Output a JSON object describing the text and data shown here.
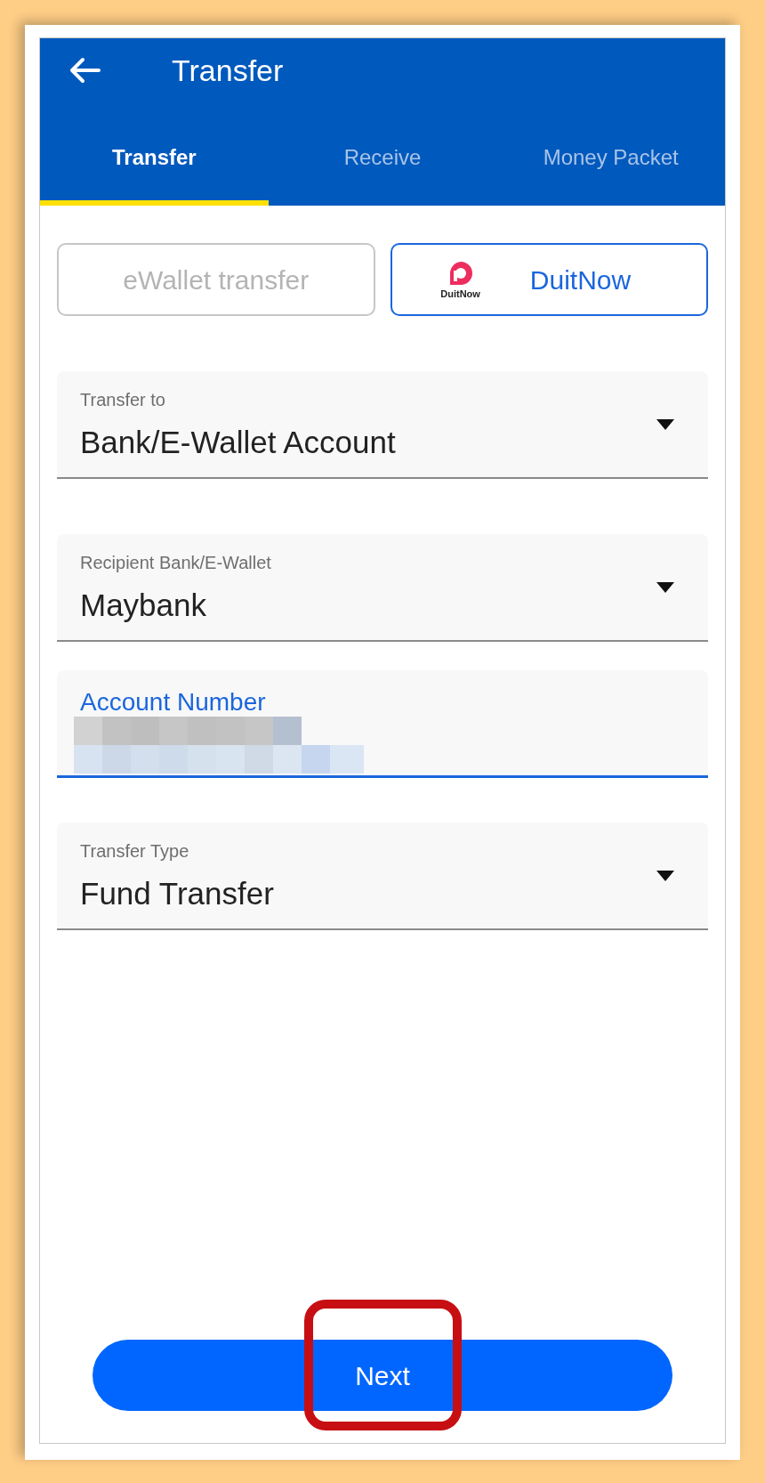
{
  "header": {
    "title": "Transfer"
  },
  "tabs": [
    {
      "label": "Transfer",
      "selected": true
    },
    {
      "label": "Receive",
      "selected": false
    },
    {
      "label": "Money Packet",
      "selected": false
    }
  ],
  "methods": [
    {
      "label": "eWallet transfer",
      "selected": false,
      "kind": "text"
    },
    {
      "label": "DuitNow",
      "selected": true,
      "kind": "logo",
      "logo_text": "DuitNow"
    }
  ],
  "fields": [
    {
      "kind": "dropdown",
      "label": "Transfer to",
      "value": "Bank/E-Wallet Account",
      "focused": false
    },
    {
      "kind": "dropdown",
      "label": "Recipient Bank/E-Wallet",
      "value": "Maybank",
      "focused": false
    },
    {
      "kind": "redacted",
      "label": "Account Number",
      "focused": true
    },
    {
      "kind": "dropdown",
      "label": "Transfer Type",
      "value": "Fund Transfer",
      "focused": false
    }
  ],
  "next_button": {
    "label": "Next"
  }
}
